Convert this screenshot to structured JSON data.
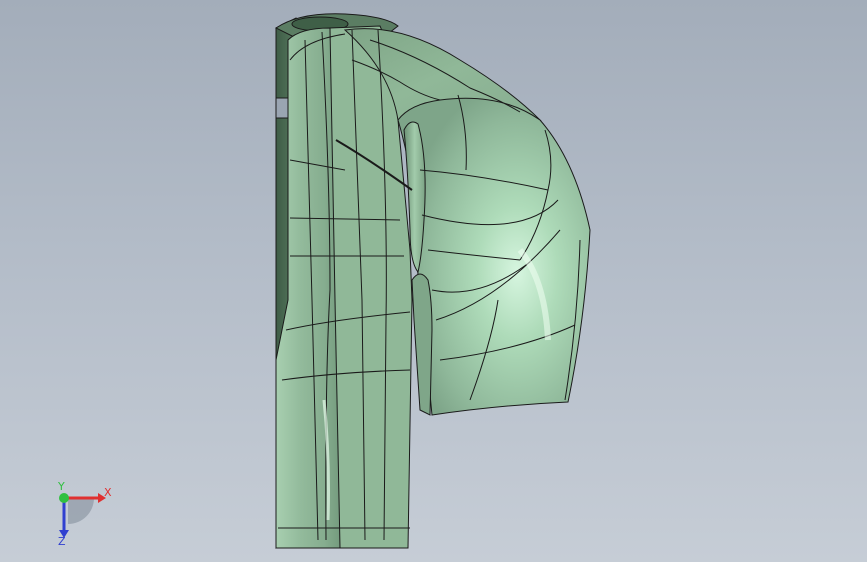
{
  "viewport": {
    "background_top": "#a3adba",
    "background_bottom": "#c6cdd6"
  },
  "model": {
    "name": "cad-part",
    "face_color": "#8fb89a",
    "face_shadow_color": "#5f7f68",
    "face_highlight_color": "#c9ecd3",
    "edge_color": "#1a1a1a"
  },
  "triad": {
    "x_label": "X",
    "y_label": "Y",
    "z_label": "Z",
    "x_color": "#e03030",
    "y_color": "#30c040",
    "z_color": "#3040d0"
  }
}
